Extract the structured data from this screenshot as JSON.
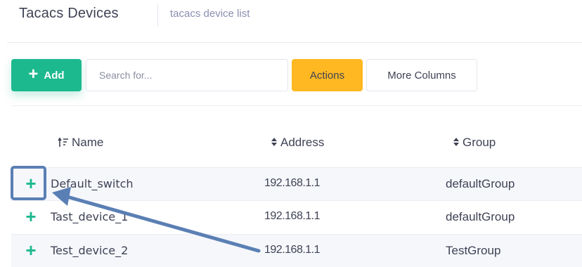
{
  "header": {
    "title": "Tacacs Devices",
    "subtitle": "tacacs device list"
  },
  "toolbar": {
    "add_label": "Add",
    "search_placeholder": "Search for...",
    "actions_label": "Actions",
    "more_columns_label": "More Columns"
  },
  "table": {
    "columns": [
      "Name",
      "Address",
      "Group"
    ],
    "rows": [
      {
        "name": "Default_switch",
        "address": "192.168.1.1",
        "group": "defaultGroup"
      },
      {
        "name": "Tast_device_1",
        "address": "192.168.1.1",
        "group": "defaultGroup"
      },
      {
        "name": "Test_device_2",
        "address": "192.168.1.1",
        "group": "TestGroup"
      }
    ]
  },
  "icons": {
    "add": "plus-icon",
    "expand": "plus-icon",
    "sort_name": "sort-ascending-icon",
    "sort_other": "sort-icon"
  },
  "colors": {
    "add_button": "#1cb98e",
    "actions_button": "#ffb822",
    "expand_icon": "#1cb98e",
    "annotation": "#5a7fb4"
  }
}
